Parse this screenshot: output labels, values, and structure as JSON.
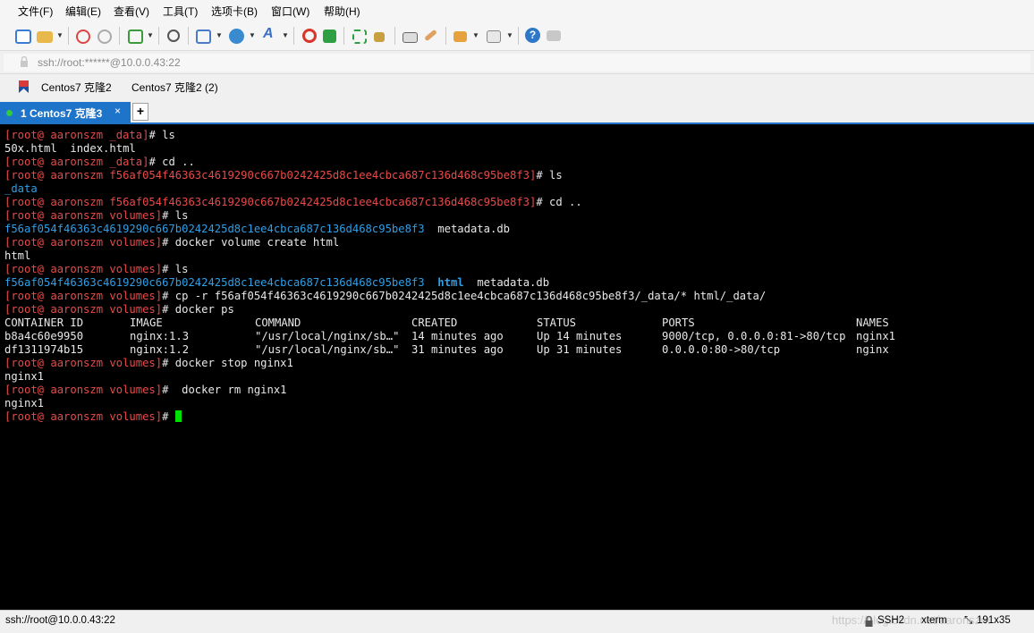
{
  "menu": [
    "文件(F)",
    "编辑(E)",
    "查看(V)",
    "工具(T)",
    "选项卡(B)",
    "窗口(W)",
    "帮助(H)"
  ],
  "address": {
    "text": "ssh://root:******@10.0.0.43:22"
  },
  "sessions": [
    "Centos7 克隆2",
    "Centos7 克隆2 (2)"
  ],
  "tab": {
    "label": "1 Centos7 克隆3",
    "close": "×",
    "add": "+"
  },
  "colors": {
    "prompt": "#e84a4a",
    "dir": "#2f9fe6",
    "tab_active": "#1e74c8",
    "cursor": "#00e000"
  },
  "terminal": {
    "prompt_root": "[root@ aaronszm ",
    "lines": [
      {
        "dir": "_data",
        "cmd": "# ls"
      },
      {
        "out": "50x.html  index.html"
      },
      {
        "dir": "_data",
        "cmd": "# cd .."
      },
      {
        "dir": "f56af054f46363c4619290c667b0242425d8c1ee4cbca687c136d468c95be8f3",
        "cmd": "# ls"
      },
      {
        "out_dir": "_data"
      },
      {
        "dir": "f56af054f46363c4619290c667b0242425d8c1ee4cbca687c136d468c95be8f3",
        "cmd": "# cd .."
      },
      {
        "dir": "volumes",
        "cmd": "# ls"
      },
      {
        "ls_a": "f56af054f46363c4619290c667b0242425d8c1ee4cbca687c136d468c95be8f3",
        "ls_b": "  metadata.db"
      },
      {
        "dir": "volumes",
        "cmd": "# docker volume create html"
      },
      {
        "out": "html"
      },
      {
        "dir": "volumes",
        "cmd": "# ls"
      },
      {
        "ls_a": "f56af054f46363c4619290c667b0242425d8c1ee4cbca687c136d468c95be8f3",
        "ls_h": "html",
        "ls_b": "metadata.db"
      },
      {
        "dir": "volumes",
        "cmd": "# cp -r f56af054f46363c4619290c667b0242425d8c1ee4cbca687c136d468c95be8f3/_data/* html/_data/"
      },
      {
        "dir": "volumes",
        "cmd": "# docker ps"
      }
    ],
    "ps_table": {
      "headers": [
        "CONTAINER ID",
        "IMAGE",
        "COMMAND",
        "CREATED",
        "STATUS",
        "PORTS",
        "NAMES"
      ],
      "rows": [
        [
          "b8a4c60e9950",
          "nginx:1.3",
          "\"/usr/local/nginx/sb…\"",
          "14 minutes ago",
          "Up 14 minutes",
          "9000/tcp, 0.0.0.0:81->80/tcp",
          "nginx1"
        ],
        [
          "df1311974b15",
          "nginx:1.2",
          "\"/usr/local/nginx/sb…\"",
          "31 minutes ago",
          "Up 31 minutes",
          "0.0.0.0:80->80/tcp",
          "nginx"
        ]
      ]
    },
    "tail": [
      {
        "dir": "volumes",
        "cmd": "# docker stop nginx1"
      },
      {
        "out": "nginx1"
      },
      {
        "dir": "volumes",
        "cmd": "#  docker rm nginx1"
      },
      {
        "out": "nginx1"
      },
      {
        "dir": "volumes",
        "cmd": "# ",
        "cursor": true
      }
    ]
  },
  "status": {
    "connection": "ssh://root@10.0.0.43:22",
    "protocol": "SSH2",
    "term": "xterm",
    "size": "191x35",
    "watermark": "https://blog.csdn.net/aaronszm"
  }
}
